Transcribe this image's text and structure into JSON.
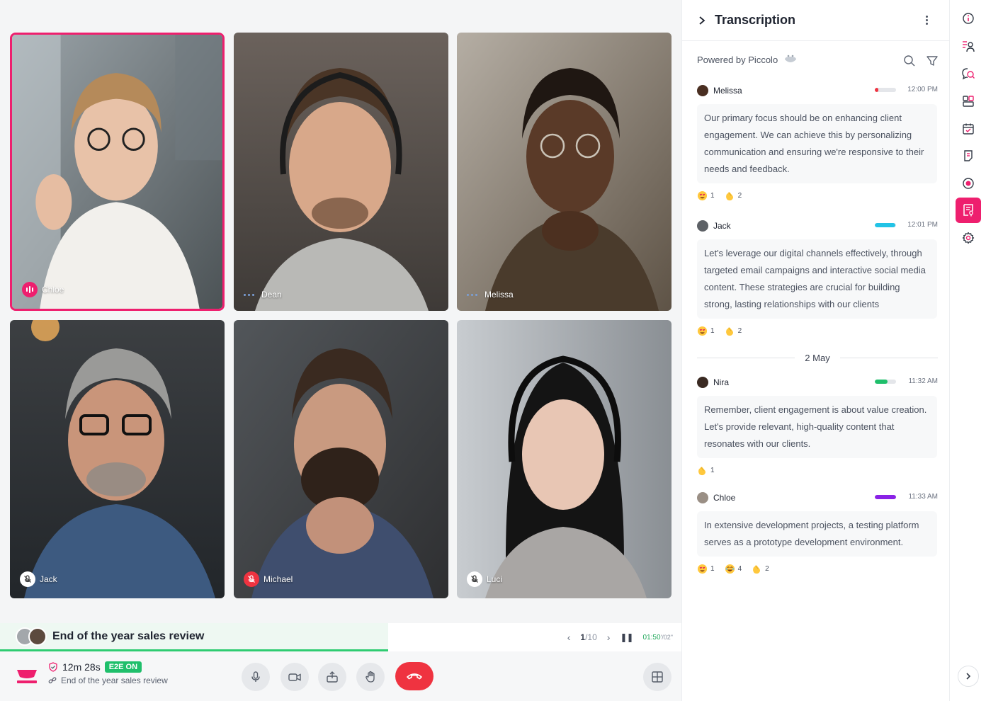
{
  "participants": [
    {
      "name": "Chloe",
      "state": "speaking"
    },
    {
      "name": "Dean",
      "state": "idle"
    },
    {
      "name": "Melissa",
      "state": "idle"
    },
    {
      "name": "Jack",
      "state": "muted"
    },
    {
      "name": "Michael",
      "state": "muted-red"
    },
    {
      "name": "Luci",
      "state": "muted"
    }
  ],
  "meeting": {
    "title": "End of the year sales review",
    "duration": "12m 28s",
    "e2e_label": "E2E ON",
    "subtitle": "End of the year sales review"
  },
  "pager": {
    "page": "1",
    "total": "/10",
    "elapsed": "01:50",
    "remaining": "'/02\""
  },
  "transcription": {
    "title": "Transcription",
    "powered_by": "Powered by Piccolo",
    "date_separator": "2 May",
    "entries": [
      {
        "speaker": "Melissa",
        "time": "12:00 PM",
        "level": 0.15,
        "level_color": "#ef3340",
        "text": "Our primary focus should be on enhancing client engagement. We can achieve this by personalizing communication and ensuring we're responsive to their needs and feedback.",
        "reactions": [
          {
            "emoji": "heart-eyes",
            "count": "1"
          },
          {
            "emoji": "clap",
            "count": "2"
          }
        ]
      },
      {
        "speaker": "Jack",
        "time": "12:01 PM",
        "level": 0.95,
        "level_color": "#22c3e6",
        "text": "Let's leverage our digital channels effectively, through targeted email campaigns and interactive social media content. These strategies are crucial for building strong, lasting relationships with our clients",
        "reactions": [
          {
            "emoji": "heart-eyes",
            "count": "1"
          },
          {
            "emoji": "clap",
            "count": "2"
          }
        ]
      },
      {
        "speaker": "Nira",
        "time": "11:32 AM",
        "level": 0.6,
        "level_color": "#1fbf6b",
        "text": "Remember, client engagement is about value creation. Let's provide relevant, high-quality content that resonates with our clients.",
        "reactions": [
          {
            "emoji": "clap",
            "count": "1"
          }
        ]
      },
      {
        "speaker": "Chloe",
        "time": "11:33 AM",
        "level": 1.0,
        "level_color": "#8a22e6",
        "text": "In extensive development projects, a testing platform serves as a prototype development environment.",
        "reactions": [
          {
            "emoji": "heart-eyes",
            "count": "1"
          },
          {
            "emoji": "laugh",
            "count": "4"
          },
          {
            "emoji": "clap",
            "count": "2"
          }
        ]
      }
    ]
  },
  "rail": {
    "items": [
      "info-icon",
      "participants-icon",
      "chat-search-icon",
      "apps-icon",
      "calendar-check-icon",
      "notes-icon",
      "record-icon",
      "transcription-icon",
      "settings-icon"
    ],
    "active": "transcription-icon"
  },
  "colors": {
    "accent": "#ee1f6e",
    "success": "#1fbf6b",
    "danger": "#ef3340"
  }
}
